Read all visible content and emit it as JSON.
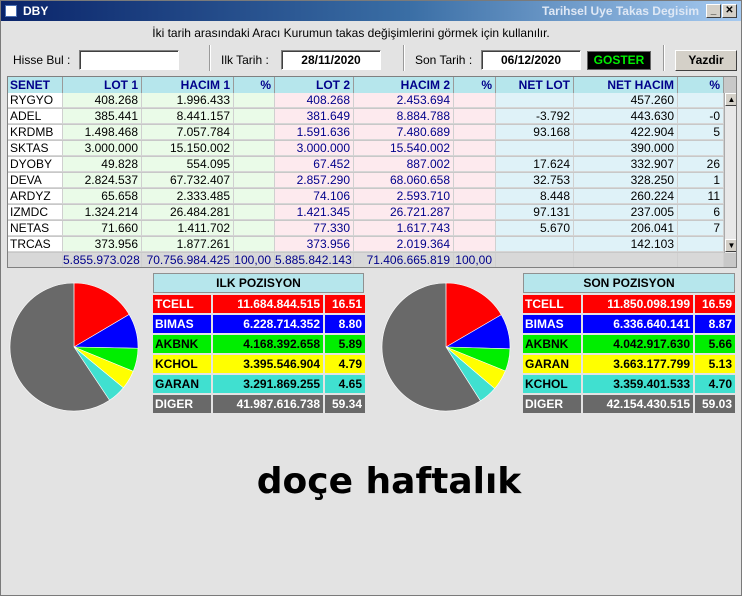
{
  "window": {
    "title": "DBY",
    "subtitle": "Tarihsel Uye Takas Degisim"
  },
  "hint": "İki tarih arasındaki  Aracı Kurumun takas değişimlerini görmek için kullanılır.",
  "controls": {
    "search_label": "Hisse Bul :",
    "search_value": "",
    "start_label": "Ilk Tarih :",
    "start_value": "28/11/2020",
    "end_label": "Son Tarih :",
    "end_value": "06/12/2020",
    "goster_label": "GOSTER",
    "yazdir_label": "Yazdir"
  },
  "table": {
    "columns": [
      "SENET",
      "LOT 1",
      "HACIM 1",
      "%",
      "LOT 2",
      "HACIM 2",
      "%",
      "NET LOT",
      "NET HACIM",
      "%"
    ],
    "rows": [
      [
        "RYGYO",
        "408.268",
        "1.996.433",
        "",
        "408.268",
        "2.453.694",
        "",
        "",
        "457.260",
        ""
      ],
      [
        "ADEL",
        "385.441",
        "8.441.157",
        "",
        "381.649",
        "8.884.788",
        "",
        "-3.792",
        "443.630",
        "-0"
      ],
      [
        "KRDMB",
        "1.498.468",
        "7.057.784",
        "",
        "1.591.636",
        "7.480.689",
        "",
        "93.168",
        "422.904",
        "5"
      ],
      [
        "SKTAS",
        "3.000.000",
        "15.150.002",
        "",
        "3.000.000",
        "15.540.002",
        "",
        "",
        "390.000",
        ""
      ],
      [
        "DYOBY",
        "49.828",
        "554.095",
        "",
        "67.452",
        "887.002",
        "",
        "17.624",
        "332.907",
        "26"
      ],
      [
        "DEVA",
        "2.824.537",
        "67.732.407",
        "",
        "2.857.290",
        "68.060.658",
        "",
        "32.753",
        "328.250",
        "1"
      ],
      [
        "ARDYZ",
        "65.658",
        "2.333.485",
        "",
        "74.106",
        "2.593.710",
        "",
        "8.448",
        "260.224",
        "11"
      ],
      [
        "IZMDC",
        "1.324.214",
        "26.484.281",
        "",
        "1.421.345",
        "26.721.287",
        "",
        "97.131",
        "237.005",
        "6"
      ],
      [
        "NETAS",
        "71.660",
        "1.411.702",
        "",
        "77.330",
        "1.617.743",
        "",
        "5.670",
        "206.041",
        "7"
      ],
      [
        "TRCAS",
        "373.956",
        "1.877.261",
        "",
        "373.956",
        "2.019.364",
        "",
        "",
        "142.103",
        ""
      ]
    ],
    "totals": [
      "",
      "5.855.973.028",
      "70.756.984.425",
      "100,00",
      "5.885.842.143",
      "71.406.665.819",
      "100,00",
      "",
      "",
      ""
    ]
  },
  "ilk": {
    "title": "ILK POZISYON",
    "items": [
      {
        "name": "TCELL",
        "value": "11.684.844.515",
        "pct": "16.51",
        "color": "#ff0000"
      },
      {
        "name": "BIMAS",
        "value": "6.228.714.352",
        "pct": "8.80",
        "color": "#0000ff"
      },
      {
        "name": "AKBNK",
        "value": "4.168.392.658",
        "pct": "5.89",
        "color": "#00ee00"
      },
      {
        "name": "KCHOL",
        "value": "3.395.546.904",
        "pct": "4.79",
        "color": "#ffff00"
      },
      {
        "name": "GARAN",
        "value": "3.291.869.255",
        "pct": "4.65",
        "color": "#40e0d0"
      },
      {
        "name": "DIGER",
        "value": "41.987.616.738",
        "pct": "59.34",
        "color": "#696969"
      }
    ]
  },
  "son": {
    "title": "SON POZISYON",
    "items": [
      {
        "name": "TCELL",
        "value": "11.850.098.199",
        "pct": "16.59",
        "color": "#ff0000"
      },
      {
        "name": "BIMAS",
        "value": "6.336.640.141",
        "pct": "8.87",
        "color": "#0000ff"
      },
      {
        "name": "AKBNK",
        "value": "4.042.917.630",
        "pct": "5.66",
        "color": "#00ee00"
      },
      {
        "name": "GARAN",
        "value": "3.663.177.799",
        "pct": "5.13",
        "color": "#ffff00"
      },
      {
        "name": "KCHOL",
        "value": "3.359.401.533",
        "pct": "4.70",
        "color": "#40e0d0"
      },
      {
        "name": "DIGER",
        "value": "42.154.430.515",
        "pct": "59.03",
        "color": "#696969"
      }
    ]
  },
  "banner": "doçe haftalık"
}
